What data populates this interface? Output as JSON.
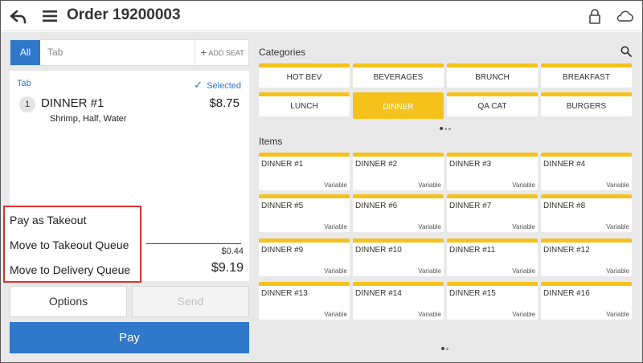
{
  "header": {
    "title": "Order 19200003",
    "icons": [
      "back-arrow-icon",
      "hamburger-menu-icon",
      "lock-icon",
      "cloud-icon"
    ]
  },
  "seat_tabs": {
    "all_label": "All",
    "tab_label": "Tab",
    "add_seat_label": "ADD SEAT"
  },
  "order": {
    "tab_label": "Tab",
    "selected_label": "Selected",
    "line_item": {
      "quantity": "1",
      "name": "DINNER #1",
      "price": "$8.75",
      "modifiers": "Shrimp, Half, Water"
    },
    "tax": "$0.44",
    "total": "$9.19"
  },
  "context_menu": {
    "items": [
      "Pay as Takeout",
      "Move to Takeout Queue",
      "Move to Delivery Queue"
    ]
  },
  "actions": {
    "options_label": "Options",
    "send_label": "Send",
    "pay_label": "Pay"
  },
  "categories": {
    "heading": "Categories",
    "selected": "DINNER",
    "list": [
      "HOT BEV",
      "BEVERAGES",
      "BRUNCH",
      "BREAKFAST",
      "LUNCH",
      "DINNER",
      "QA CAT",
      "BURGERS"
    ]
  },
  "items": {
    "heading": "Items",
    "list": [
      {
        "name": "DINNER #1",
        "price": "Variable"
      },
      {
        "name": "DINNER #2",
        "price": "Variable"
      },
      {
        "name": "DINNER #3",
        "price": "Variable"
      },
      {
        "name": "DINNER #4",
        "price": "Variable"
      },
      {
        "name": "DINNER #5",
        "price": "Variable"
      },
      {
        "name": "DINNER #6",
        "price": "Variable"
      },
      {
        "name": "DINNER #7",
        "price": "Variable"
      },
      {
        "name": "DINNER #8",
        "price": "Variable"
      },
      {
        "name": "DINNER #9",
        "price": "Variable"
      },
      {
        "name": "DINNER #10",
        "price": "Variable"
      },
      {
        "name": "DINNER #11",
        "price": "Variable"
      },
      {
        "name": "DINNER #12",
        "price": "Variable"
      },
      {
        "name": "DINNER #13",
        "price": "Variable"
      },
      {
        "name": "DINNER #14",
        "price": "Variable"
      },
      {
        "name": "DINNER #15",
        "price": "Variable"
      },
      {
        "name": "DINNER #16",
        "price": "Variable"
      }
    ]
  },
  "colors": {
    "accent_blue": "#3078c9",
    "tile_yellow": "#f4c21b",
    "highlight_red": "#e03030"
  }
}
